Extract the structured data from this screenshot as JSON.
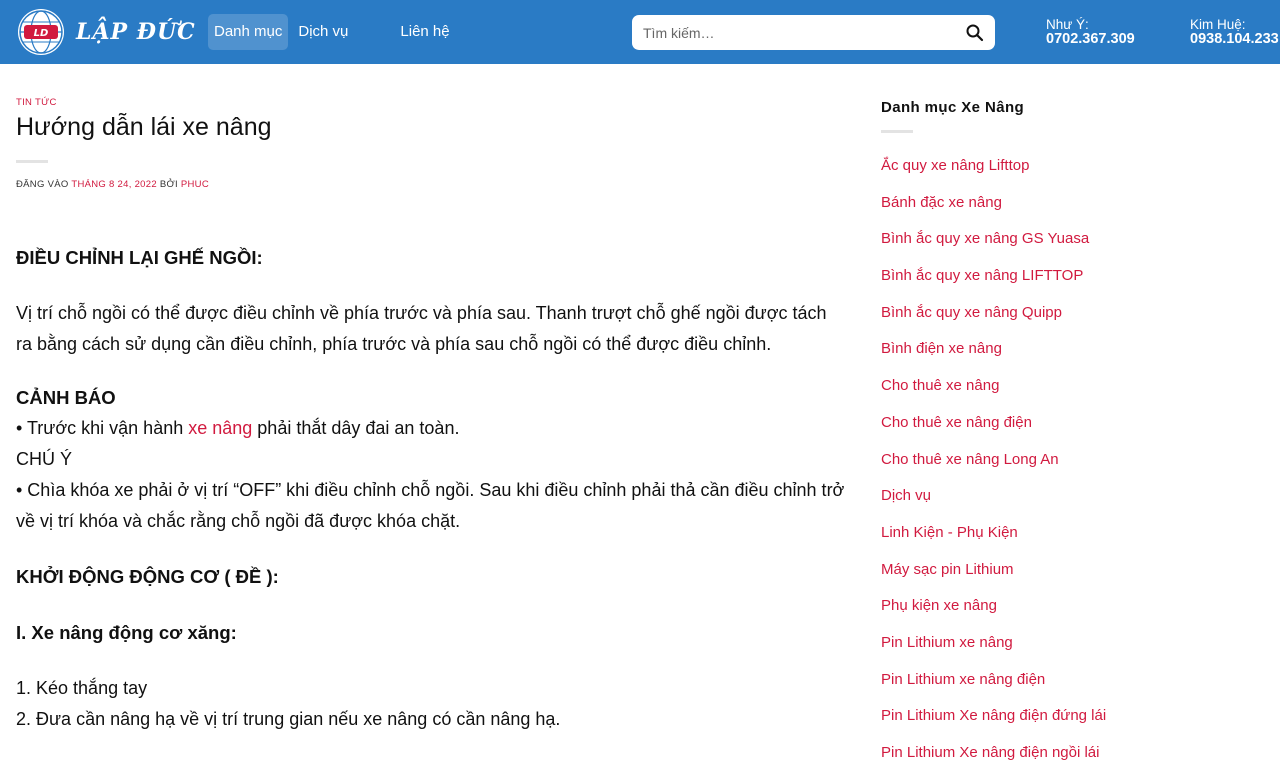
{
  "header": {
    "logo_text": "LẬP ĐỨC",
    "logo_badge": "LD",
    "nav": [
      {
        "label": "Danh mục",
        "active": true
      },
      {
        "label": "Dịch vụ",
        "active": false
      },
      {
        "label": "Liên hệ",
        "active": false
      }
    ],
    "search": {
      "placeholder": "Tìm kiếm…",
      "icon": "search-icon"
    },
    "contacts": [
      {
        "name": "Như Ý:",
        "phone": "0702.367.309"
      },
      {
        "name": "Kim Huệ:",
        "phone": "0938.104.233"
      }
    ],
    "colors": {
      "bar": "#2a7bc5",
      "accent": "#d11a3f"
    }
  },
  "article": {
    "category": "TIN TỨC",
    "title": "Hướng dẫn lái xe nâng",
    "meta": {
      "posted_on": "ĐĂNG VÀO",
      "date": "THÁNG 8 24, 2022",
      "by": "BỞI",
      "author": "PHUC"
    },
    "heading1": "ĐIỀU CHỈNH LẠI GHẾ NGỒI:",
    "para1": "Vị trí chỗ ngồi có thể được điều chỉnh về phía trước và phía sau. Thanh trượt chỗ ghế ngồi được tách ra bằng cách sử dụng cần điều chỉnh, phía trước và phía sau chỗ ngồi có thể được điều chỉnh.",
    "warning_heading": "CẢNH BÁO",
    "warning_pre": "• Trước khi vận hành ",
    "warning_link": "xe nâng",
    "warning_post": " phải thắt dây đai an toàn.",
    "note_heading": "CHÚ Ý",
    "note_text": "• Chìa khóa xe phải ở vị trí “OFF” khi điều chỉnh chỗ ngồi. Sau khi điều chỉnh phải thả cần điều chỉnh trở về vị trí khóa và chắc rằng chỗ ngồi đã được khóa chặt.",
    "heading2": "KHỞI ĐỘNG ĐỘNG CƠ ( ĐỀ ):",
    "heading3": "I. Xe nâng động cơ xăng:",
    "steps": [
      "1. Kéo thắng tay",
      "2. Đưa cần nâng hạ về vị trí trung gian nếu xe nâng có cần nâng hạ."
    ]
  },
  "sidebar": {
    "title": "Danh mục Xe Nâng",
    "items": [
      "Ắc quy xe nâng Lifttop",
      "Bánh đặc xe nâng",
      "Bình ắc quy xe nâng GS Yuasa",
      "Bình ắc quy xe nâng LIFTTOP",
      "Bình ắc quy xe nâng Quipp",
      "Bình điện xe nâng",
      "Cho thuê xe nâng",
      "Cho thuê xe nâng điện",
      "Cho thuê xe nâng Long An",
      "Dịch vụ",
      "Linh Kiện - Phụ Kiện",
      "Máy sạc pin Lithium",
      "Phụ kiện xe nâng",
      "Pin Lithium xe nâng",
      "Pin Lithium xe nâng điện",
      "Pin Lithium Xe nâng điện đứng lái",
      "Pin Lithium Xe nâng điện ngồi lái"
    ]
  }
}
